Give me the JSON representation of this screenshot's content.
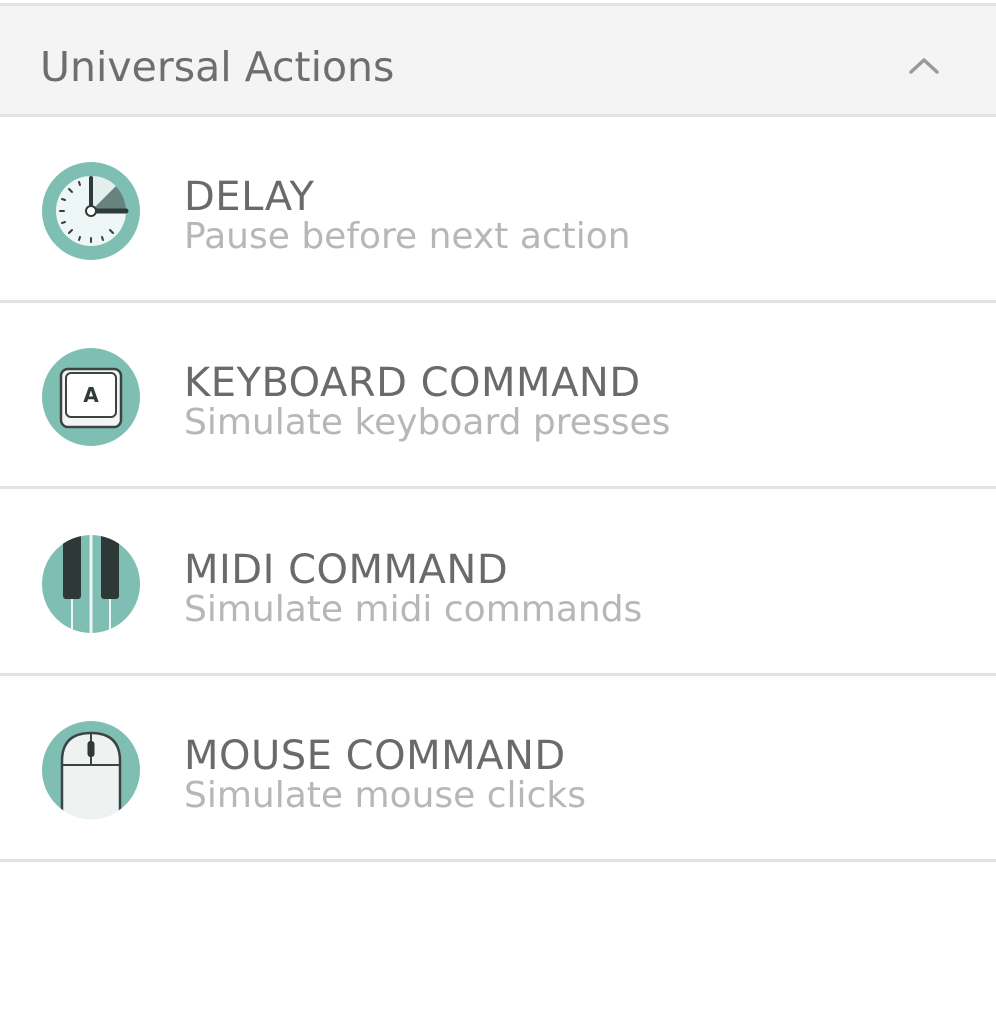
{
  "section": {
    "title": "Universal Actions",
    "chevron_icon": "chevron-up-icon"
  },
  "colors": {
    "icon_bg": "#7fbfb3",
    "header_bg": "#f4f4f4",
    "title_text": "#6a6a6a",
    "desc_text": "#b7b7b7",
    "divider": "#e2e2e2"
  },
  "actions": [
    {
      "title": "DELAY",
      "description": "Pause before next action",
      "icon": "clock-icon"
    },
    {
      "title": "KEYBOARD COMMAND",
      "description": "Simulate keyboard presses",
      "icon": "keyboard-key-icon",
      "key_letter": "A"
    },
    {
      "title": "MIDI COMMAND",
      "description": "Simulate midi commands",
      "icon": "piano-keys-icon"
    },
    {
      "title": "MOUSE COMMAND",
      "description": "Simulate mouse clicks",
      "icon": "mouse-icon"
    }
  ]
}
